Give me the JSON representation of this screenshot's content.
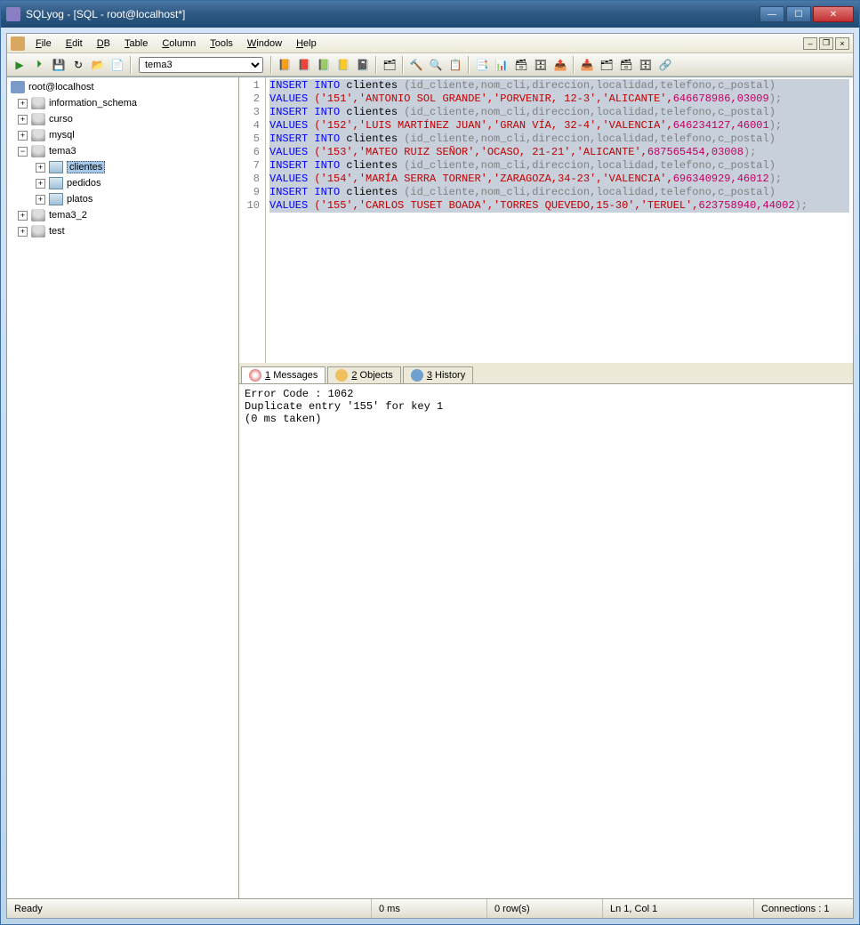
{
  "window": {
    "title": "SQLyog - [SQL - root@localhost*]"
  },
  "menu": {
    "file": "File",
    "edit": "Edit",
    "db": "DB",
    "table": "Table",
    "column": "Column",
    "tools": "Tools",
    "window": "Window",
    "help": "Help"
  },
  "db_dropdown": "tema3",
  "tree": {
    "root": "root@localhost",
    "dbs": [
      "information_schema",
      "curso",
      "mysql"
    ],
    "tema3": {
      "name": "tema3",
      "tables": [
        "clientes",
        "pedidos",
        "platos"
      ],
      "selected": "clientes"
    },
    "rest": [
      "tema3_2",
      "test"
    ]
  },
  "sql": [
    {
      "k": "INSERT INTO",
      "t": " clientes ",
      "c": "(id_cliente,nom_cli,direccion,localidad,telefono,c_postal)"
    },
    {
      "k": "VALUES ",
      "v": "('151','ANTONIO SOL GRANDE','PORVENIR, 12-3','ALICANTE',",
      "n": "646678986,03009",
      "e": ");"
    },
    {
      "k": "INSERT INTO",
      "t": " clientes ",
      "c": "(id_cliente,nom_cli,direccion,localidad,telefono,c_postal)"
    },
    {
      "k": "VALUES ",
      "v": "('152','LUIS MARTÍNEZ JUAN','GRAN VÍA, 32-4','VALENCIA',",
      "n": "646234127,46001",
      "e": ");"
    },
    {
      "k": "INSERT INTO",
      "t": " clientes ",
      "c": "(id_cliente,nom_cli,direccion,localidad,telefono,c_postal)"
    },
    {
      "k": "VALUES ",
      "v": "('153','MATEO RUIZ SEÑOR','OCASO, 21-21','ALICANTE',",
      "n": "687565454,03008",
      "e": ");"
    },
    {
      "k": "INSERT INTO",
      "t": " clientes ",
      "c": "(id_cliente,nom_cli,direccion,localidad,telefono,c_postal)"
    },
    {
      "k": "VALUES ",
      "v": "('154','MARÍA SERRA TORNER','ZARAGOZA,34-23','VALENCIA',",
      "n": "696340929,46012",
      "e": ");"
    },
    {
      "k": "INSERT INTO",
      "t": " clientes ",
      "c": "(id_cliente,nom_cli,direccion,localidad,telefono,c_postal)"
    },
    {
      "k": "VALUES ",
      "v": "('155','CARLOS TUSET BOADA','TORRES QUEVEDO,15-30','TERUEL',",
      "n": "623758940,44002",
      "e": ");"
    }
  ],
  "tabs": {
    "messages": "1 Messages",
    "objects": "2 Objects",
    "history": "3 History"
  },
  "messages": "Error Code : 1062\nDuplicate entry '155' for key 1\n(0 ms taken)",
  "status": {
    "ready": "Ready",
    "time": "0 ms",
    "rows": "0 row(s)",
    "pos": "Ln 1, Col 1",
    "conn": "Connections : 1"
  }
}
